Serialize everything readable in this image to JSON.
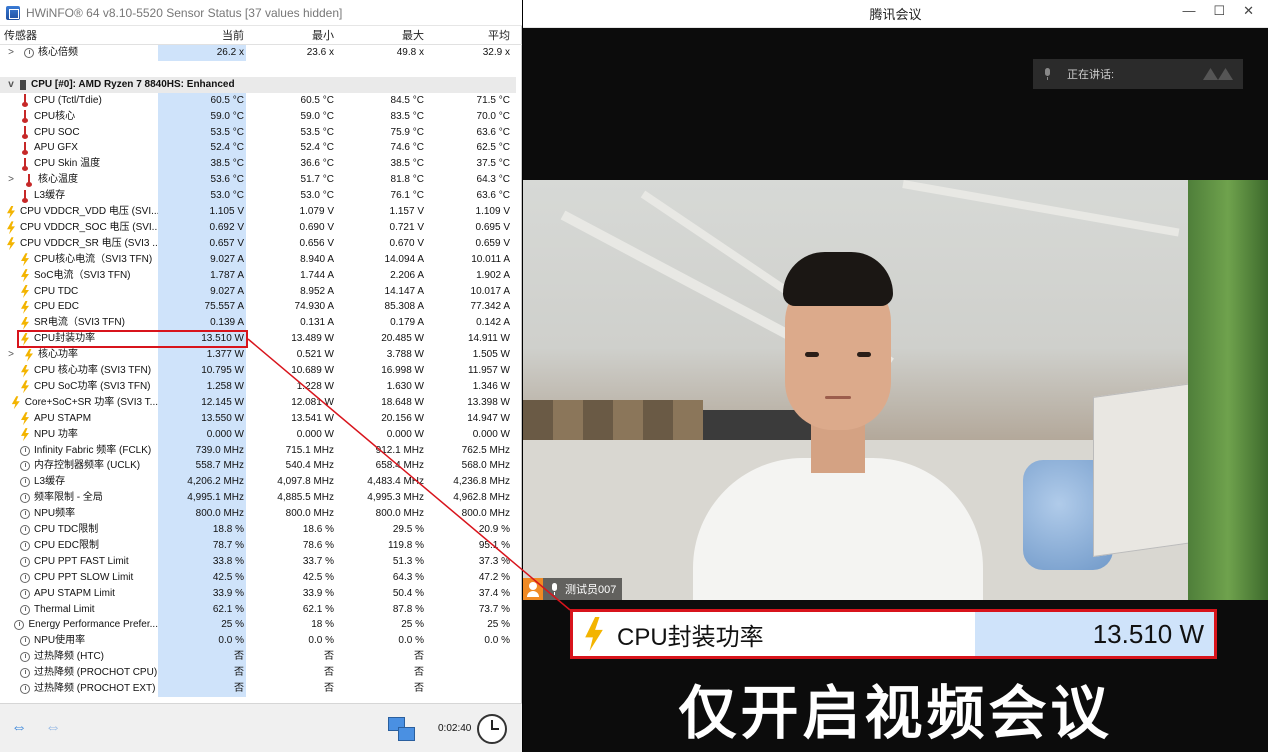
{
  "hwinfo": {
    "title": "HWiNFO® 64 v8.10-5520 Sensor Status [37 values hidden]",
    "columns": {
      "name": "传感器",
      "current": "当前",
      "min": "最小",
      "max": "最大",
      "avg": "平均"
    },
    "rows": [
      {
        "type": "sensor",
        "exp": ">",
        "icon": "clock",
        "indent": 1,
        "name": "核心倍频",
        "cur": "26.2 x",
        "min": "23.6 x",
        "max": "49.8 x",
        "avg": "32.9 x"
      },
      {
        "type": "blank"
      },
      {
        "type": "group",
        "exp": "v",
        "icon": "chip",
        "name": "CPU [#0]: AMD Ryzen 7 8840HS: Enhanced"
      },
      {
        "type": "sensor",
        "icon": "therm",
        "name": "CPU (Tctl/Tdie)",
        "cur": "60.5 °C",
        "min": "60.5 °C",
        "max": "84.5 °C",
        "avg": "71.5 °C"
      },
      {
        "type": "sensor",
        "icon": "therm",
        "name": "CPU核心",
        "cur": "59.0 °C",
        "min": "59.0 °C",
        "max": "83.5 °C",
        "avg": "70.0 °C"
      },
      {
        "type": "sensor",
        "icon": "therm",
        "name": "CPU SOC",
        "cur": "53.5 °C",
        "min": "53.5 °C",
        "max": "75.9 °C",
        "avg": "63.6 °C"
      },
      {
        "type": "sensor",
        "icon": "therm",
        "name": "APU GFX",
        "cur": "52.4 °C",
        "min": "52.4 °C",
        "max": "74.6 °C",
        "avg": "62.5 °C"
      },
      {
        "type": "sensor",
        "icon": "therm",
        "name": "CPU Skin 温度",
        "cur": "38.5 °C",
        "min": "36.6 °C",
        "max": "38.5 °C",
        "avg": "37.5 °C"
      },
      {
        "type": "sensor",
        "exp": ">",
        "icon": "therm",
        "indent": 1,
        "name": "核心温度",
        "cur": "53.6 °C",
        "min": "51.7 °C",
        "max": "81.8 °C",
        "avg": "64.3 °C"
      },
      {
        "type": "sensor",
        "icon": "therm",
        "name": "L3缓存",
        "cur": "53.0 °C",
        "min": "53.0 °C",
        "max": "76.1 °C",
        "avg": "63.6 °C"
      },
      {
        "type": "sensor",
        "icon": "bolt",
        "name": "CPU VDDCR_VDD 电压 (SVI...",
        "cur": "1.105 V",
        "min": "1.079 V",
        "max": "1.157 V",
        "avg": "1.109 V"
      },
      {
        "type": "sensor",
        "icon": "bolt",
        "name": "CPU VDDCR_SOC 电压 (SVI...",
        "cur": "0.692 V",
        "min": "0.690 V",
        "max": "0.721 V",
        "avg": "0.695 V"
      },
      {
        "type": "sensor",
        "icon": "bolt",
        "name": "CPU VDDCR_SR 电压 (SVI3 ...",
        "cur": "0.657 V",
        "min": "0.656 V",
        "max": "0.670 V",
        "avg": "0.659 V"
      },
      {
        "type": "sensor",
        "icon": "bolt",
        "name": "CPU核心电流（SVI3 TFN)",
        "cur": "9.027 A",
        "min": "8.940 A",
        "max": "14.094 A",
        "avg": "10.011 A"
      },
      {
        "type": "sensor",
        "icon": "bolt",
        "name": "SoC电流（SVI3 TFN)",
        "cur": "1.787 A",
        "min": "1.744 A",
        "max": "2.206 A",
        "avg": "1.902 A"
      },
      {
        "type": "sensor",
        "icon": "bolt",
        "name": "CPU TDC",
        "cur": "9.027 A",
        "min": "8.952 A",
        "max": "14.147 A",
        "avg": "10.017 A"
      },
      {
        "type": "sensor",
        "icon": "bolt",
        "name": "CPU EDC",
        "cur": "75.557 A",
        "min": "74.930 A",
        "max": "85.308 A",
        "avg": "77.342 A"
      },
      {
        "type": "sensor",
        "icon": "bolt",
        "name": "SR电流（SVI3 TFN)",
        "cur": "0.139 A",
        "min": "0.131 A",
        "max": "0.179 A",
        "avg": "0.142 A"
      },
      {
        "type": "sensor",
        "icon": "bolt",
        "name": "CPU封装功率",
        "cur": "13.510 W",
        "min": "13.489 W",
        "max": "20.485 W",
        "avg": "14.911 W"
      },
      {
        "type": "sensor",
        "exp": ">",
        "icon": "bolt",
        "indent": 1,
        "name": "核心功率",
        "cur": "1.377 W",
        "min": "0.521 W",
        "max": "3.788 W",
        "avg": "1.505 W"
      },
      {
        "type": "sensor",
        "icon": "bolt",
        "name": "CPU 核心功率 (SVI3 TFN)",
        "cur": "10.795 W",
        "min": "10.689 W",
        "max": "16.998 W",
        "avg": "11.957 W"
      },
      {
        "type": "sensor",
        "icon": "bolt",
        "name": "CPU SoC功率 (SVI3 TFN)",
        "cur": "1.258 W",
        "min": "1.228 W",
        "max": "1.630 W",
        "avg": "1.346 W"
      },
      {
        "type": "sensor",
        "icon": "bolt",
        "name": "Core+SoC+SR 功率 (SVI3 T...",
        "cur": "12.145 W",
        "min": "12.081 W",
        "max": "18.648 W",
        "avg": "13.398 W"
      },
      {
        "type": "sensor",
        "icon": "bolt",
        "name": "APU STAPM",
        "cur": "13.550 W",
        "min": "13.541 W",
        "max": "20.156 W",
        "avg": "14.947 W"
      },
      {
        "type": "sensor",
        "icon": "bolt",
        "name": "NPU 功率",
        "cur": "0.000 W",
        "min": "0.000 W",
        "max": "0.000 W",
        "avg": "0.000 W"
      },
      {
        "type": "sensor",
        "icon": "clock",
        "name": "Infinity Fabric 频率 (FCLK)",
        "cur": "739.0 MHz",
        "min": "715.1 MHz",
        "max": "912.1 MHz",
        "avg": "762.5 MHz"
      },
      {
        "type": "sensor",
        "icon": "clock",
        "name": "内存控制器频率 (UCLK)",
        "cur": "558.7 MHz",
        "min": "540.4 MHz",
        "max": "658.4 MHz",
        "avg": "568.0 MHz"
      },
      {
        "type": "sensor",
        "icon": "clock",
        "name": "L3缓存",
        "cur": "4,206.2 MHz",
        "min": "4,097.8 MHz",
        "max": "4,483.4 MHz",
        "avg": "4,236.8 MHz"
      },
      {
        "type": "sensor",
        "icon": "clock",
        "name": "频率限制 - 全局",
        "cur": "4,995.1 MHz",
        "min": "4,885.5 MHz",
        "max": "4,995.3 MHz",
        "avg": "4,962.8 MHz"
      },
      {
        "type": "sensor",
        "icon": "clock",
        "name": "NPU频率",
        "cur": "800.0 MHz",
        "min": "800.0 MHz",
        "max": "800.0 MHz",
        "avg": "800.0 MHz"
      },
      {
        "type": "sensor",
        "icon": "clock",
        "name": "CPU TDC限制",
        "cur": "18.8 %",
        "min": "18.6 %",
        "max": "29.5 %",
        "avg": "20.9 %"
      },
      {
        "type": "sensor",
        "icon": "clock",
        "name": "CPU EDC限制",
        "cur": "78.7 %",
        "min": "78.6 %",
        "max": "119.8 %",
        "avg": "95.1 %"
      },
      {
        "type": "sensor",
        "icon": "clock",
        "name": "CPU PPT FAST Limit",
        "cur": "33.8 %",
        "min": "33.7 %",
        "max": "51.3 %",
        "avg": "37.3 %"
      },
      {
        "type": "sensor",
        "icon": "clock",
        "name": "CPU PPT SLOW Limit",
        "cur": "42.5 %",
        "min": "42.5 %",
        "max": "64.3 %",
        "avg": "47.2 %"
      },
      {
        "type": "sensor",
        "icon": "clock",
        "name": "APU STAPM Limit",
        "cur": "33.9 %",
        "min": "33.9 %",
        "max": "50.4 %",
        "avg": "37.4 %"
      },
      {
        "type": "sensor",
        "icon": "clock",
        "name": "Thermal Limit",
        "cur": "62.1 %",
        "min": "62.1 %",
        "max": "87.8 %",
        "avg": "73.7 %"
      },
      {
        "type": "sensor",
        "icon": "clock",
        "name": "Energy Performance Prefer...",
        "cur": "25 %",
        "min": "18 %",
        "max": "25 %",
        "avg": "25 %"
      },
      {
        "type": "sensor",
        "icon": "clock",
        "name": "NPU使用率",
        "cur": "0.0 %",
        "min": "0.0 %",
        "max": "0.0 %",
        "avg": "0.0 %"
      },
      {
        "type": "sensor",
        "icon": "clock",
        "name": "过热降频 (HTC)",
        "cur": "否",
        "min": "否",
        "max": "否",
        "avg": ""
      },
      {
        "type": "sensor",
        "icon": "clock",
        "name": "过热降频 (PROCHOT CPU)",
        "cur": "否",
        "min": "否",
        "max": "否",
        "avg": ""
      },
      {
        "type": "sensor",
        "icon": "clock",
        "name": "过热降频 (PROCHOT EXT)",
        "cur": "否",
        "min": "否",
        "max": "否",
        "avg": ""
      }
    ],
    "timer": "0:02:40",
    "nav_left": "⇔",
    "nav_right": "⇔"
  },
  "meeting": {
    "title": "腾讯会议",
    "controls": {
      "minimize": "—",
      "maximize": "☐",
      "close": "✕"
    },
    "speaking_label": "正在讲话:",
    "participant_name": "测试员007"
  },
  "callout": {
    "label": "CPU封装功率",
    "value": "13.510 W"
  },
  "caption": "仅开启视频会议",
  "colors": {
    "highlight": "#d8141c",
    "current_column": "#cfe3fa",
    "bolt": "#f3b400",
    "avatar": "#f08a24"
  }
}
